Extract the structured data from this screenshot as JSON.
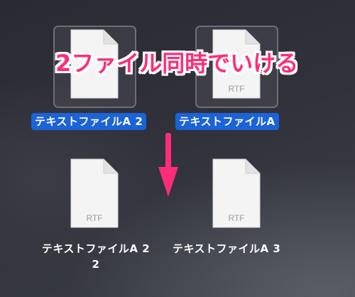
{
  "desktop": {
    "files": [
      {
        "name": "テキストファイルA 2",
        "type_label": "",
        "selected": true
      },
      {
        "name": "テキストファイルA",
        "type_label": "RTF",
        "selected": true
      },
      {
        "name": "テキストファイルA 2 2",
        "name_line1": "テキストファイルA 2",
        "name_line2": "2",
        "type_label": "RTF",
        "selected": false
      },
      {
        "name": "テキストファイルA 3",
        "type_label": "RTF",
        "selected": false
      }
    ]
  },
  "annotation": {
    "text": "2ファイル同時でいける",
    "color": "#ff2d78"
  },
  "icons": {
    "document": "document-icon",
    "arrow": "arrow-down-icon"
  },
  "colors": {
    "selection": "#1b63d8",
    "annotation": "#ff2d78",
    "arrow": "#ff2d78"
  }
}
